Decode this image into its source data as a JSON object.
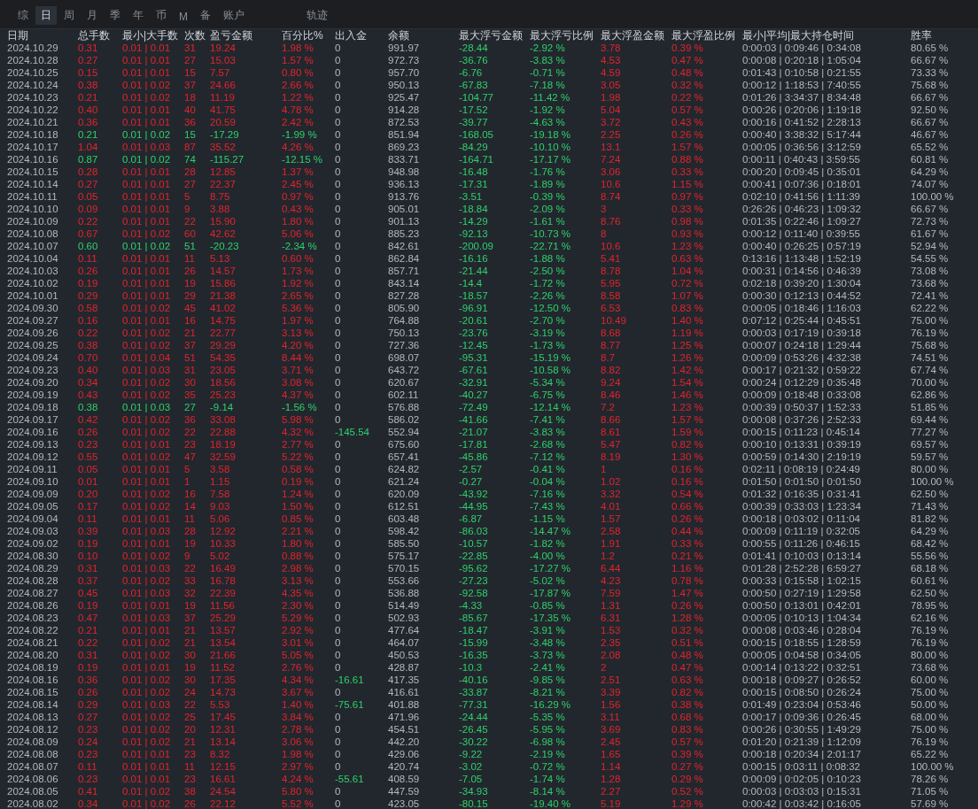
{
  "tabs": [
    {
      "label": "综",
      "selected": false
    },
    {
      "label": "日",
      "selected": true
    },
    {
      "label": "周",
      "selected": false
    },
    {
      "label": "月",
      "selected": false
    },
    {
      "label": "季",
      "selected": false
    },
    {
      "label": "年",
      "selected": false
    },
    {
      "label": "币",
      "selected": false
    },
    {
      "label": "M",
      "selected": false
    },
    {
      "label": "备",
      "selected": false
    },
    {
      "label": "账户",
      "selected": false
    },
    {
      "label": "轨迹",
      "selected": false
    }
  ],
  "table": {
    "columns": [
      "日期",
      "总手数",
      "最小|大手数",
      "次数",
      "盈亏金额",
      "百分比%",
      "出入金",
      "余额",
      "最大浮亏金额",
      "最大浮亏比例",
      "最大浮盈金额",
      "最大浮盈比例",
      "最小|平均|最大持仓时间",
      "胜率"
    ],
    "rows": [
      {
        "loss": false,
        "transfer": false,
        "cells": [
          "2024.10.29",
          "0.31",
          "0.01 | 0.01",
          "31",
          "19.24",
          "1.98 %",
          "0",
          "991.97",
          "-28.44",
          "-2.92 %",
          "3.78",
          "0.39 %",
          "0:00:03 | 0:09:46 | 0:34:08",
          "80.65 %"
        ]
      },
      {
        "loss": false,
        "transfer": false,
        "cells": [
          "2024.10.28",
          "0.27",
          "0.01 | 0.01",
          "27",
          "15.03",
          "1.57 %",
          "0",
          "972.73",
          "-36.76",
          "-3.83 %",
          "4.53",
          "0.47 %",
          "0:00:08 | 0:20:18 | 1:05:04",
          "66.67 %"
        ]
      },
      {
        "loss": false,
        "transfer": false,
        "cells": [
          "2024.10.25",
          "0.15",
          "0.01 | 0.01",
          "15",
          "7.57",
          "0.80 %",
          "0",
          "957.70",
          "-6.76",
          "-0.71 %",
          "4.59",
          "0.48 %",
          "0:01:43 | 0:10:58 | 0:21:55",
          "73.33 %"
        ]
      },
      {
        "loss": false,
        "transfer": false,
        "cells": [
          "2024.10.24",
          "0.38",
          "0.01 | 0.02",
          "37",
          "24.66",
          "2.66 %",
          "0",
          "950.13",
          "-67.83",
          "-7.18 %",
          "3.05",
          "0.32 %",
          "0:00:12 | 1:18:53 | 7:40:55",
          "75.68 %"
        ]
      },
      {
        "loss": false,
        "transfer": false,
        "cells": [
          "2024.10.23",
          "0.21",
          "0.01 | 0.02",
          "18",
          "11.19",
          "1.22 %",
          "0",
          "925.47",
          "-104.77",
          "-11.42 %",
          "1.98",
          "0.22 %",
          "0:01:26 | 3:34:37 | 8:34:48",
          "66.67 %"
        ]
      },
      {
        "loss": false,
        "transfer": false,
        "cells": [
          "2024.10.22",
          "0.40",
          "0.01 | 0.01",
          "40",
          "41.75",
          "4.78 %",
          "0",
          "914.28",
          "-17.52",
          "-1.92 %",
          "5.04",
          "0.57 %",
          "0:00:26 | 0:20:06 | 1:19:18",
          "92.50 %"
        ]
      },
      {
        "loss": false,
        "transfer": false,
        "cells": [
          "2024.10.21",
          "0.36",
          "0.01 | 0.01",
          "36",
          "20.59",
          "2.42 %",
          "0",
          "872.53",
          "-39.77",
          "-4.63 %",
          "3.72",
          "0.43 %",
          "0:00:16 | 0:41:52 | 2:28:13",
          "66.67 %"
        ]
      },
      {
        "loss": true,
        "transfer": false,
        "cells": [
          "2024.10.18",
          "0.21",
          "0.01 | 0.02",
          "15",
          "-17.29",
          "-1.99 %",
          "0",
          "851.94",
          "-168.05",
          "-19.18 %",
          "2.25",
          "0.26 %",
          "0:00:40 | 3:38:32 | 5:17:44",
          "46.67 %"
        ]
      },
      {
        "loss": false,
        "transfer": false,
        "cells": [
          "2024.10.17",
          "1.04",
          "0.01 | 0.03",
          "87",
          "35.52",
          "4.26 %",
          "0",
          "869.23",
          "-84.29",
          "-10.10 %",
          "13.1",
          "1.57 %",
          "0:00:05 | 0:36:56 | 3:12:59",
          "65.52 %"
        ]
      },
      {
        "loss": true,
        "transfer": false,
        "cells": [
          "2024.10.16",
          "0.87",
          "0.01 | 0.02",
          "74",
          "-115.27",
          "-12.15 %",
          "0",
          "833.71",
          "-164.71",
          "-17.17 %",
          "7.24",
          "0.88 %",
          "0:00:11 | 0:40:43 | 3:59:55",
          "60.81 %"
        ]
      },
      {
        "loss": false,
        "transfer": false,
        "cells": [
          "2024.10.15",
          "0.28",
          "0.01 | 0.01",
          "28",
          "12.85",
          "1.37 %",
          "0",
          "948.98",
          "-16.48",
          "-1.76 %",
          "3.06",
          "0.33 %",
          "0:00:20 | 0:09:45 | 0:35:01",
          "64.29 %"
        ]
      },
      {
        "loss": false,
        "transfer": false,
        "cells": [
          "2024.10.14",
          "0.27",
          "0.01 | 0.01",
          "27",
          "22.37",
          "2.45 %",
          "0",
          "936.13",
          "-17.31",
          "-1.89 %",
          "10.6",
          "1.15 %",
          "0:00:41 | 0:07:36 | 0:18:01",
          "74.07 %"
        ]
      },
      {
        "loss": false,
        "transfer": false,
        "cells": [
          "2024.10.11",
          "0.05",
          "0.01 | 0.01",
          "5",
          "8.75",
          "0.97 %",
          "0",
          "913.76",
          "-3.51",
          "-0.39 %",
          "8.74",
          "0.97 %",
          "0:02:10 | 0:41:56 | 1:11:39",
          "100.00 %"
        ]
      },
      {
        "loss": false,
        "transfer": false,
        "cells": [
          "2024.10.10",
          "0.09",
          "0.01 | 0.01",
          "9",
          "3.88",
          "0.43 %",
          "0",
          "905.01",
          "-18.84",
          "-2.09 %",
          "3",
          "0.33 %",
          "0:26:26 | 0:46:23 | 1:09:32",
          "66.67 %"
        ]
      },
      {
        "loss": false,
        "transfer": false,
        "cells": [
          "2024.10.09",
          "0.22",
          "0.01 | 0.01",
          "22",
          "15.90",
          "1.80 %",
          "0",
          "901.13",
          "-14.29",
          "-1.61 %",
          "8.76",
          "0.98 %",
          "0:01:35 | 0:22:46 | 1:09:27",
          "72.73 %"
        ]
      },
      {
        "loss": false,
        "transfer": false,
        "cells": [
          "2024.10.08",
          "0.67",
          "0.01 | 0.02",
          "60",
          "42.62",
          "5.06 %",
          "0",
          "885.23",
          "-92.13",
          "-10.73 %",
          "8",
          "0.93 %",
          "0:00:12 | 0:11:40 | 0:39:55",
          "61.67 %"
        ]
      },
      {
        "loss": true,
        "transfer": false,
        "cells": [
          "2024.10.07",
          "0.60",
          "0.01 | 0.02",
          "51",
          "-20.23",
          "-2.34 %",
          "0",
          "842.61",
          "-200.09",
          "-22.71 %",
          "10.6",
          "1.23 %",
          "0:00:40 | 0:26:25 | 0:57:19",
          "52.94 %"
        ]
      },
      {
        "loss": false,
        "transfer": false,
        "cells": [
          "2024.10.04",
          "0.11",
          "0.01 | 0.01",
          "11",
          "5.13",
          "0.60 %",
          "0",
          "862.84",
          "-16.16",
          "-1.88 %",
          "5.41",
          "0.63 %",
          "0:13:16 | 1:13:48 | 1:52:19",
          "54.55 %"
        ]
      },
      {
        "loss": false,
        "transfer": false,
        "cells": [
          "2024.10.03",
          "0.26",
          "0.01 | 0.01",
          "26",
          "14.57",
          "1.73 %",
          "0",
          "857.71",
          "-21.44",
          "-2.50 %",
          "8.78",
          "1.04 %",
          "0:00:31 | 0:14:56 | 0:46:39",
          "73.08 %"
        ]
      },
      {
        "loss": false,
        "transfer": false,
        "cells": [
          "2024.10.02",
          "0.19",
          "0.01 | 0.01",
          "19",
          "15.86",
          "1.92 %",
          "0",
          "843.14",
          "-14.4",
          "-1.72 %",
          "5.95",
          "0.72 %",
          "0:02:18 | 0:39:20 | 1:30:04",
          "73.68 %"
        ]
      },
      {
        "loss": false,
        "transfer": false,
        "cells": [
          "2024.10.01",
          "0.29",
          "0.01 | 0.01",
          "29",
          "21.38",
          "2.65 %",
          "0",
          "827.28",
          "-18.57",
          "-2.26 %",
          "8.58",
          "1.07 %",
          "0:00:30 | 0:12:13 | 0:44:52",
          "72.41 %"
        ]
      },
      {
        "loss": false,
        "transfer": false,
        "cells": [
          "2024.09.30",
          "0.58",
          "0.01 | 0.02",
          "45",
          "41.02",
          "5.36 %",
          "0",
          "805.90",
          "-96.91",
          "-12.50 %",
          "6.53",
          "0.83 %",
          "0:00:05 | 0:18:46 | 1:16:03",
          "62.22 %"
        ]
      },
      {
        "loss": false,
        "transfer": false,
        "cells": [
          "2024.09.27",
          "0.16",
          "0.01 | 0.01",
          "16",
          "14.75",
          "1.97 %",
          "0",
          "764.88",
          "-20.61",
          "-2.70 %",
          "10.49",
          "1.40 %",
          "0:07:12 | 0:25:44 | 0:45:51",
          "75.00 %"
        ]
      },
      {
        "loss": false,
        "transfer": false,
        "cells": [
          "2024.09.26",
          "0.22",
          "0.01 | 0.02",
          "21",
          "22.77",
          "3.13 %",
          "0",
          "750.13",
          "-23.76",
          "-3.19 %",
          "8.68",
          "1.19 %",
          "0:00:03 | 0:17:19 | 0:39:18",
          "76.19 %"
        ]
      },
      {
        "loss": false,
        "transfer": false,
        "cells": [
          "2024.09.25",
          "0.38",
          "0.01 | 0.02",
          "37",
          "29.29",
          "4.20 %",
          "0",
          "727.36",
          "-12.45",
          "-1.73 %",
          "8.77",
          "1.25 %",
          "0:00:07 | 0:24:18 | 1:29:44",
          "75.68 %"
        ]
      },
      {
        "loss": false,
        "transfer": false,
        "cells": [
          "2024.09.24",
          "0.70",
          "0.01 | 0.04",
          "51",
          "54.35",
          "8.44 %",
          "0",
          "698.07",
          "-95.31",
          "-15.19 %",
          "8.7",
          "1.26 %",
          "0:00:09 | 0:53:26 | 4:32:38",
          "74.51 %"
        ]
      },
      {
        "loss": false,
        "transfer": false,
        "cells": [
          "2024.09.23",
          "0.40",
          "0.01 | 0.03",
          "31",
          "23.05",
          "3.71 %",
          "0",
          "643.72",
          "-67.61",
          "-10.58 %",
          "8.82",
          "1.42 %",
          "0:00:17 | 0:21:32 | 0:59:22",
          "67.74 %"
        ]
      },
      {
        "loss": false,
        "transfer": false,
        "cells": [
          "2024.09.20",
          "0.34",
          "0.01 | 0.02",
          "30",
          "18.56",
          "3.08 %",
          "0",
          "620.67",
          "-32.91",
          "-5.34 %",
          "9.24",
          "1.54 %",
          "0:00:24 | 0:12:29 | 0:35:48",
          "70.00 %"
        ]
      },
      {
        "loss": false,
        "transfer": false,
        "cells": [
          "2024.09.19",
          "0.43",
          "0.01 | 0.02",
          "35",
          "25.23",
          "4.37 %",
          "0",
          "602.11",
          "-40.27",
          "-6.75 %",
          "8.46",
          "1.46 %",
          "0:00:09 | 0:18:48 | 0:33:08",
          "62.86 %"
        ]
      },
      {
        "loss": true,
        "transfer": false,
        "cells": [
          "2024.09.18",
          "0.38",
          "0.01 | 0.03",
          "27",
          "-9.14",
          "-1.56 %",
          "0",
          "576.88",
          "-72.49",
          "-12.14 %",
          "7.2",
          "1.23 %",
          "0:00:39 | 0:50:37 | 1:52:33",
          "51.85 %"
        ]
      },
      {
        "loss": false,
        "transfer": false,
        "cells": [
          "2024.09.17",
          "0.42",
          "0.01 | 0.02",
          "36",
          "33.08",
          "5.98 %",
          "0",
          "586.02",
          "-41.66",
          "-7.41 %",
          "8.66",
          "1.57 %",
          "0:00:08 | 0:37:26 | 2:52:33",
          "69.44 %"
        ]
      },
      {
        "loss": false,
        "transfer": true,
        "cells": [
          "2024.09.16",
          "0.26",
          "0.01 | 0.02",
          "22",
          "22.88",
          "4.32 %",
          "-145.54",
          "552.94",
          "-21.07",
          "-3.83 %",
          "8.61",
          "1.59 %",
          "0:00:15 | 0:11:23 | 0:45:14",
          "77.27 %"
        ]
      },
      {
        "loss": false,
        "transfer": false,
        "cells": [
          "2024.09.13",
          "0.23",
          "0.01 | 0.01",
          "23",
          "18.19",
          "2.77 %",
          "0",
          "675.60",
          "-17.81",
          "-2.68 %",
          "5.47",
          "0.82 %",
          "0:00:10 | 0:13:31 | 0:39:19",
          "69.57 %"
        ]
      },
      {
        "loss": false,
        "transfer": false,
        "cells": [
          "2024.09.12",
          "0.55",
          "0.01 | 0.02",
          "47",
          "32.59",
          "5.22 %",
          "0",
          "657.41",
          "-45.86",
          "-7.12 %",
          "8.19",
          "1.30 %",
          "0:00:59 | 0:14:30 | 2:19:19",
          "59.57 %"
        ]
      },
      {
        "loss": false,
        "transfer": false,
        "cells": [
          "2024.09.11",
          "0.05",
          "0.01 | 0.01",
          "5",
          "3.58",
          "0.58 %",
          "0",
          "624.82",
          "-2.57",
          "-0.41 %",
          "1",
          "0.16 %",
          "0:02:11 | 0:08:19 | 0:24:49",
          "80.00 %"
        ]
      },
      {
        "loss": false,
        "transfer": false,
        "cells": [
          "2024.09.10",
          "0.01",
          "0.01 | 0.01",
          "1",
          "1.15",
          "0.19 %",
          "0",
          "621.24",
          "-0.27",
          "-0.04 %",
          "1.02",
          "0.16 %",
          "0:01:50 | 0:01:50 | 0:01:50",
          "100.00 %"
        ]
      },
      {
        "loss": false,
        "transfer": false,
        "cells": [
          "2024.09.09",
          "0.20",
          "0.01 | 0.02",
          "16",
          "7.58",
          "1.24 %",
          "0",
          "620.09",
          "-43.92",
          "-7.16 %",
          "3.32",
          "0.54 %",
          "0:01:32 | 0:16:35 | 0:31:41",
          "62.50 %"
        ]
      },
      {
        "loss": false,
        "transfer": false,
        "cells": [
          "2024.09.05",
          "0.17",
          "0.01 | 0.02",
          "14",
          "9.03",
          "1.50 %",
          "0",
          "612.51",
          "-44.95",
          "-7.43 %",
          "4.01",
          "0.66 %",
          "0:00:39 | 0:33:03 | 1:23:34",
          "71.43 %"
        ]
      },
      {
        "loss": false,
        "transfer": false,
        "cells": [
          "2024.09.04",
          "0.11",
          "0.01 | 0.01",
          "11",
          "5.06",
          "0.85 %",
          "0",
          "603.48",
          "-6.87",
          "-1.15 %",
          "1.57",
          "0.26 %",
          "0:00:18 | 0:03:02 | 0:11:04",
          "81.82 %"
        ]
      },
      {
        "loss": false,
        "transfer": false,
        "cells": [
          "2024.09.03",
          "0.39",
          "0.01 | 0.03",
          "28",
          "12.92",
          "2.21 %",
          "0",
          "598.42",
          "-86.03",
          "-14.47 %",
          "2.58",
          "0.44 %",
          "0:00:09 | 0:11:19 | 0:32:05",
          "64.29 %"
        ]
      },
      {
        "loss": false,
        "transfer": false,
        "cells": [
          "2024.09.02",
          "0.19",
          "0.01 | 0.01",
          "19",
          "10.33",
          "1.80 %",
          "0",
          "585.50",
          "-10.57",
          "-1.82 %",
          "1.91",
          "0.33 %",
          "0:00:55 | 0:11:26 | 0:46:15",
          "68.42 %"
        ]
      },
      {
        "loss": false,
        "transfer": false,
        "cells": [
          "2024.08.30",
          "0.10",
          "0.01 | 0.02",
          "9",
          "5.02",
          "0.88 %",
          "0",
          "575.17",
          "-22.85",
          "-4.00 %",
          "1.2",
          "0.21 %",
          "0:01:41 | 0:10:03 | 0:13:14",
          "55.56 %"
        ]
      },
      {
        "loss": false,
        "transfer": false,
        "cells": [
          "2024.08.29",
          "0.31",
          "0.01 | 0.03",
          "22",
          "16.49",
          "2.98 %",
          "0",
          "570.15",
          "-95.62",
          "-17.27 %",
          "6.44",
          "1.16 %",
          "0:01:28 | 2:52:28 | 6:59:27",
          "68.18 %"
        ]
      },
      {
        "loss": false,
        "transfer": false,
        "cells": [
          "2024.08.28",
          "0.37",
          "0.01 | 0.02",
          "33",
          "16.78",
          "3.13 %",
          "0",
          "553.66",
          "-27.23",
          "-5.02 %",
          "4.23",
          "0.78 %",
          "0:00:33 | 0:15:58 | 1:02:15",
          "60.61 %"
        ]
      },
      {
        "loss": false,
        "transfer": false,
        "cells": [
          "2024.08.27",
          "0.45",
          "0.01 | 0.03",
          "32",
          "22.39",
          "4.35 %",
          "0",
          "536.88",
          "-92.58",
          "-17.87 %",
          "7.59",
          "1.47 %",
          "0:00:50 | 0:27:19 | 1:29:58",
          "62.50 %"
        ]
      },
      {
        "loss": false,
        "transfer": false,
        "cells": [
          "2024.08.26",
          "0.19",
          "0.01 | 0.01",
          "19",
          "11.56",
          "2.30 %",
          "0",
          "514.49",
          "-4.33",
          "-0.85 %",
          "1.31",
          "0.26 %",
          "0:00:50 | 0:13:01 | 0:42:01",
          "78.95 %"
        ]
      },
      {
        "loss": false,
        "transfer": false,
        "cells": [
          "2024.08.23",
          "0.47",
          "0.01 | 0.03",
          "37",
          "25.29",
          "5.29 %",
          "0",
          "502.93",
          "-85.67",
          "-17.35 %",
          "6.31",
          "1.28 %",
          "0:00:05 | 0:10:13 | 1:04:34",
          "62.16 %"
        ]
      },
      {
        "loss": false,
        "transfer": false,
        "cells": [
          "2024.08.22",
          "0.21",
          "0.01 | 0.01",
          "21",
          "13.57",
          "2.92 %",
          "0",
          "477.64",
          "-18.47",
          "-3.91 %",
          "1.53",
          "0.32 %",
          "0:00:08 | 0:03:46 | 0:28:04",
          "76.19 %"
        ]
      },
      {
        "loss": false,
        "transfer": false,
        "cells": [
          "2024.08.21",
          "0.22",
          "0.01 | 0.02",
          "21",
          "13.54",
          "3.01 %",
          "0",
          "464.07",
          "-15.99",
          "-3.48 %",
          "2.35",
          "0.51 %",
          "0:00:15 | 0:18:55 | 1:28:59",
          "76.19 %"
        ]
      },
      {
        "loss": false,
        "transfer": false,
        "cells": [
          "2024.08.20",
          "0.31",
          "0.01 | 0.02",
          "30",
          "21.66",
          "5.05 %",
          "0",
          "450.53",
          "-16.35",
          "-3.73 %",
          "2.08",
          "0.48 %",
          "0:00:05 | 0:04:58 | 0:34:05",
          "80.00 %"
        ]
      },
      {
        "loss": false,
        "transfer": false,
        "cells": [
          "2024.08.19",
          "0.19",
          "0.01 | 0.01",
          "19",
          "11.52",
          "2.76 %",
          "0",
          "428.87",
          "-10.3",
          "-2.41 %",
          "2",
          "0.47 %",
          "0:00:14 | 0:13:22 | 0:32:51",
          "73.68 %"
        ]
      },
      {
        "loss": false,
        "transfer": true,
        "cells": [
          "2024.08.16",
          "0.36",
          "0.01 | 0.02",
          "30",
          "17.35",
          "4.34 %",
          "-16.61",
          "417.35",
          "-40.16",
          "-9.85 %",
          "2.51",
          "0.63 %",
          "0:00:18 | 0:09:27 | 0:26:52",
          "60.00 %"
        ]
      },
      {
        "loss": false,
        "transfer": false,
        "cells": [
          "2024.08.15",
          "0.26",
          "0.01 | 0.02",
          "24",
          "14.73",
          "3.67 %",
          "0",
          "416.61",
          "-33.87",
          "-8.21 %",
          "3.39",
          "0.82 %",
          "0:00:15 | 0:08:50 | 0:26:24",
          "75.00 %"
        ]
      },
      {
        "loss": false,
        "transfer": true,
        "cells": [
          "2024.08.14",
          "0.29",
          "0.01 | 0.03",
          "22",
          "5.53",
          "1.40 %",
          "-75.61",
          "401.88",
          "-77.31",
          "-16.29 %",
          "1.56",
          "0.38 %",
          "0:01:49 | 0:23:04 | 0:53:46",
          "50.00 %"
        ]
      },
      {
        "loss": false,
        "transfer": false,
        "cells": [
          "2024.08.13",
          "0.27",
          "0.01 | 0.02",
          "25",
          "17.45",
          "3.84 %",
          "0",
          "471.96",
          "-24.44",
          "-5.35 %",
          "3.11",
          "0.68 %",
          "0:00:17 | 0:09:36 | 0:26:45",
          "68.00 %"
        ]
      },
      {
        "loss": false,
        "transfer": false,
        "cells": [
          "2024.08.12",
          "0.23",
          "0.01 | 0.02",
          "20",
          "12.31",
          "2.78 %",
          "0",
          "454.51",
          "-26.45",
          "-5.95 %",
          "3.69",
          "0.83 %",
          "0:00:26 | 0:30:55 | 1:49:29",
          "75.00 %"
        ]
      },
      {
        "loss": false,
        "transfer": false,
        "cells": [
          "2024.08.09",
          "0.24",
          "0.01 | 0.02",
          "21",
          "13.14",
          "3.06 %",
          "0",
          "442.20",
          "-30.22",
          "-6.98 %",
          "2.45",
          "0.57 %",
          "0:01:20 | 0:21:39 | 1:12:09",
          "76.19 %"
        ]
      },
      {
        "loss": false,
        "transfer": false,
        "cells": [
          "2024.08.08",
          "0.23",
          "0.01 | 0.01",
          "23",
          "8.32",
          "1.98 %",
          "0",
          "429.06",
          "-9.22",
          "-2.19 %",
          "1.65",
          "0.39 %",
          "0:00:18 | 0:20:34 | 2:01:17",
          "65.22 %"
        ]
      },
      {
        "loss": false,
        "transfer": false,
        "cells": [
          "2024.08.07",
          "0.11",
          "0.01 | 0.01",
          "11",
          "12.15",
          "2.97 %",
          "0",
          "420.74",
          "-3.02",
          "-0.72 %",
          "1.14",
          "0.27 %",
          "0:00:15 | 0:03:11 | 0:08:32",
          "100.00 %"
        ]
      },
      {
        "loss": false,
        "transfer": true,
        "cells": [
          "2024.08.06",
          "0.23",
          "0.01 | 0.01",
          "23",
          "16.61",
          "4.24 %",
          "-55.61",
          "408.59",
          "-7.05",
          "-1.74 %",
          "1.28",
          "0.29 %",
          "0:00:09 | 0:02:05 | 0:10:23",
          "78.26 %"
        ]
      },
      {
        "loss": false,
        "transfer": false,
        "cells": [
          "2024.08.05",
          "0.41",
          "0.01 | 0.02",
          "38",
          "24.54",
          "5.80 %",
          "0",
          "447.59",
          "-34.93",
          "-8.14 %",
          "2.27",
          "0.52 %",
          "0:00:03 | 0:03:03 | 0:15:31",
          "71.05 %"
        ]
      },
      {
        "loss": false,
        "transfer": false,
        "cells": [
          "2024.08.02",
          "0.34",
          "0.01 | 0.02",
          "26",
          "22.12",
          "5.52 %",
          "0",
          "423.05",
          "-80.15",
          "-19.40 %",
          "5.19",
          "1.29 %",
          "0:00:42 | 0:03:42 | 0:16:05",
          "57.69 %"
        ]
      }
    ]
  }
}
